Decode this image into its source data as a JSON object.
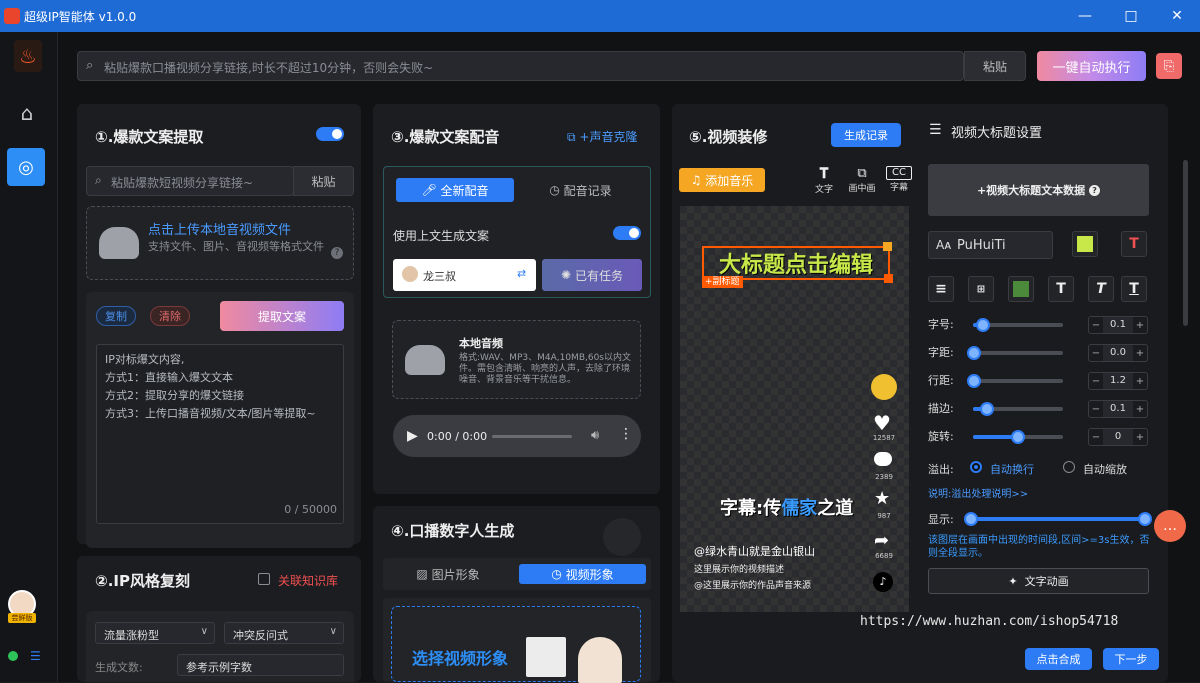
{
  "app": {
    "title": "超级IP智能体 v1.0.0"
  },
  "topbar": {
    "search_placeholder": "粘贴爆款口播视频分享链接,时长不超过10分钟，否则会失败~",
    "paste_label": "粘贴",
    "run_label": "一键自动执行"
  },
  "rail": {
    "user_badge": "尝鲜版"
  },
  "p1": {
    "title": "①.爆款文案提取",
    "link_placeholder": "粘贴爆款短视频分享链接~",
    "paste_label": "粘贴",
    "upload_title": "点击上传本地音视频文件",
    "upload_sub": "支持文件、图片、音视频等格式文件",
    "copy_label": "复制",
    "clear_label": "清除",
    "extract_label": "提取文案",
    "text_lines": [
      "IP对标爆文内容,",
      "方式1：直接输入爆文文本",
      "方式2：提取分享的爆文链接",
      "方式3：上传口播音视频/文本/图片等提取~"
    ],
    "counter": "0 / 50000"
  },
  "p2": {
    "title": "②.IP风格复刻",
    "kb_label": "关联知识库",
    "select1": "流量涨粉型",
    "select2": "冲突反问式",
    "gen_label": "生成文数:",
    "select3": "参考示例字数"
  },
  "p3": {
    "title": "③.爆款文案配音",
    "clone_label": "+声音克隆",
    "tab_new": "全新配音",
    "tab_history": "配音记录",
    "use_above": "使用上文生成文案",
    "voice_name": "龙三叔",
    "tasks_label": "已有任务",
    "local_audio": "本地音频",
    "audio_desc": "格式:WAV、MP3、M4A,10MB,60s以内文件。需包含清晰、响亮的人声，去除了环境噪音、背景音乐等干扰信息。",
    "player_time": "0:00 / 0:00"
  },
  "p4": {
    "title": "④.口播数字人生成",
    "tab_image": "图片形象",
    "tab_video": "视频形象",
    "select_label": "选择视频形象"
  },
  "p5": {
    "title": "⑤.视频装修",
    "record_label": "生成记录",
    "music_label": "添加音乐",
    "tool_text": "文字",
    "tool_pip": "画中画",
    "tool_sub": "字幕",
    "big_title": "大标题点击编辑",
    "sub_tag": "+副标题",
    "caption_pre": "字幕:传",
    "caption_hl": "儒家",
    "caption_post": "之道",
    "handle": "@绿水青山就是金山银山",
    "desc1": "这里展示你的视频描述",
    "desc2": "@这里展示你的作品声音来源",
    "likes": "12587",
    "comments": "2389",
    "stars": "987",
    "shares": "6689",
    "merge_label": "点击合成",
    "next_label": "下一步"
  },
  "settings": {
    "title": "视频大标题设置",
    "add_text": "+视频大标题文本数据",
    "font": "PuHuiTi",
    "rows": [
      {
        "label": "字号:",
        "value": "0.1"
      },
      {
        "label": "字距:",
        "value": "0.0"
      },
      {
        "label": "行距:",
        "value": "1.2"
      },
      {
        "label": "描边:",
        "value": "0.1"
      },
      {
        "label": "旋转:",
        "value": "0"
      }
    ],
    "overflow_label": "溢出:",
    "opt1": "自动换行",
    "opt2": "自动缩放",
    "overflow_help": "说明:溢出处理说明>>",
    "show_label": "显示:",
    "show_note": "该图层在画面中出现的时间段,区间>=3s生效，否则全段显示。",
    "anim_label": "文字动画"
  },
  "watermark": "https://www.huzhan.com/ishop54718",
  "colors": {
    "accent": "#2d7cf6",
    "brand_gradient_start": "#f08aa0",
    "brand_gradient_end": "#8e7cf5",
    "title_yellow": "#c8e84a"
  }
}
